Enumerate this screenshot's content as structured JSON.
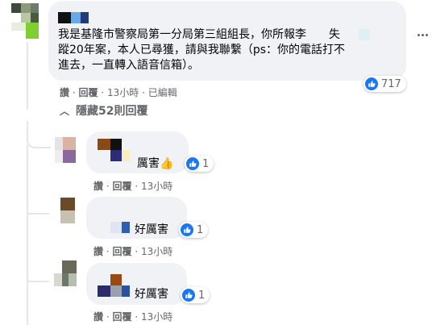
{
  "main_comment": {
    "text_lines": [
      "我是基隆市警察局第一分局第三組組長，你所報李　　失",
      "蹤20年案，本人已尋獲，請與我聯繫（ps：你的電話打不",
      "進去，一直轉入語音信箱）。"
    ],
    "reaction_count": "717",
    "actions": {
      "like": "讚",
      "reply": "回覆",
      "time": "13小時",
      "edited": "已編輯"
    }
  },
  "hidden_replies": {
    "label": "隱藏52則回覆",
    "icon": "chevron-up-icon"
  },
  "replies": [
    {
      "text": "厲害",
      "emoji": "👍",
      "reaction_count": "1",
      "actions": {
        "like": "讚",
        "reply": "回覆",
        "time": "13小時"
      }
    },
    {
      "text": "好厲害",
      "reaction_count": "1",
      "actions": {
        "like": "讚",
        "reply": "回覆",
        "time": "13小時"
      }
    },
    {
      "text": "好厲害",
      "reaction_count": "1",
      "actions": {
        "like": "讚",
        "reply": "回覆",
        "time": "13小時"
      }
    }
  ],
  "colors": {
    "bubble": "#f0f2f5",
    "secondary_text": "#65676b",
    "like_blue": "#1877f2"
  }
}
